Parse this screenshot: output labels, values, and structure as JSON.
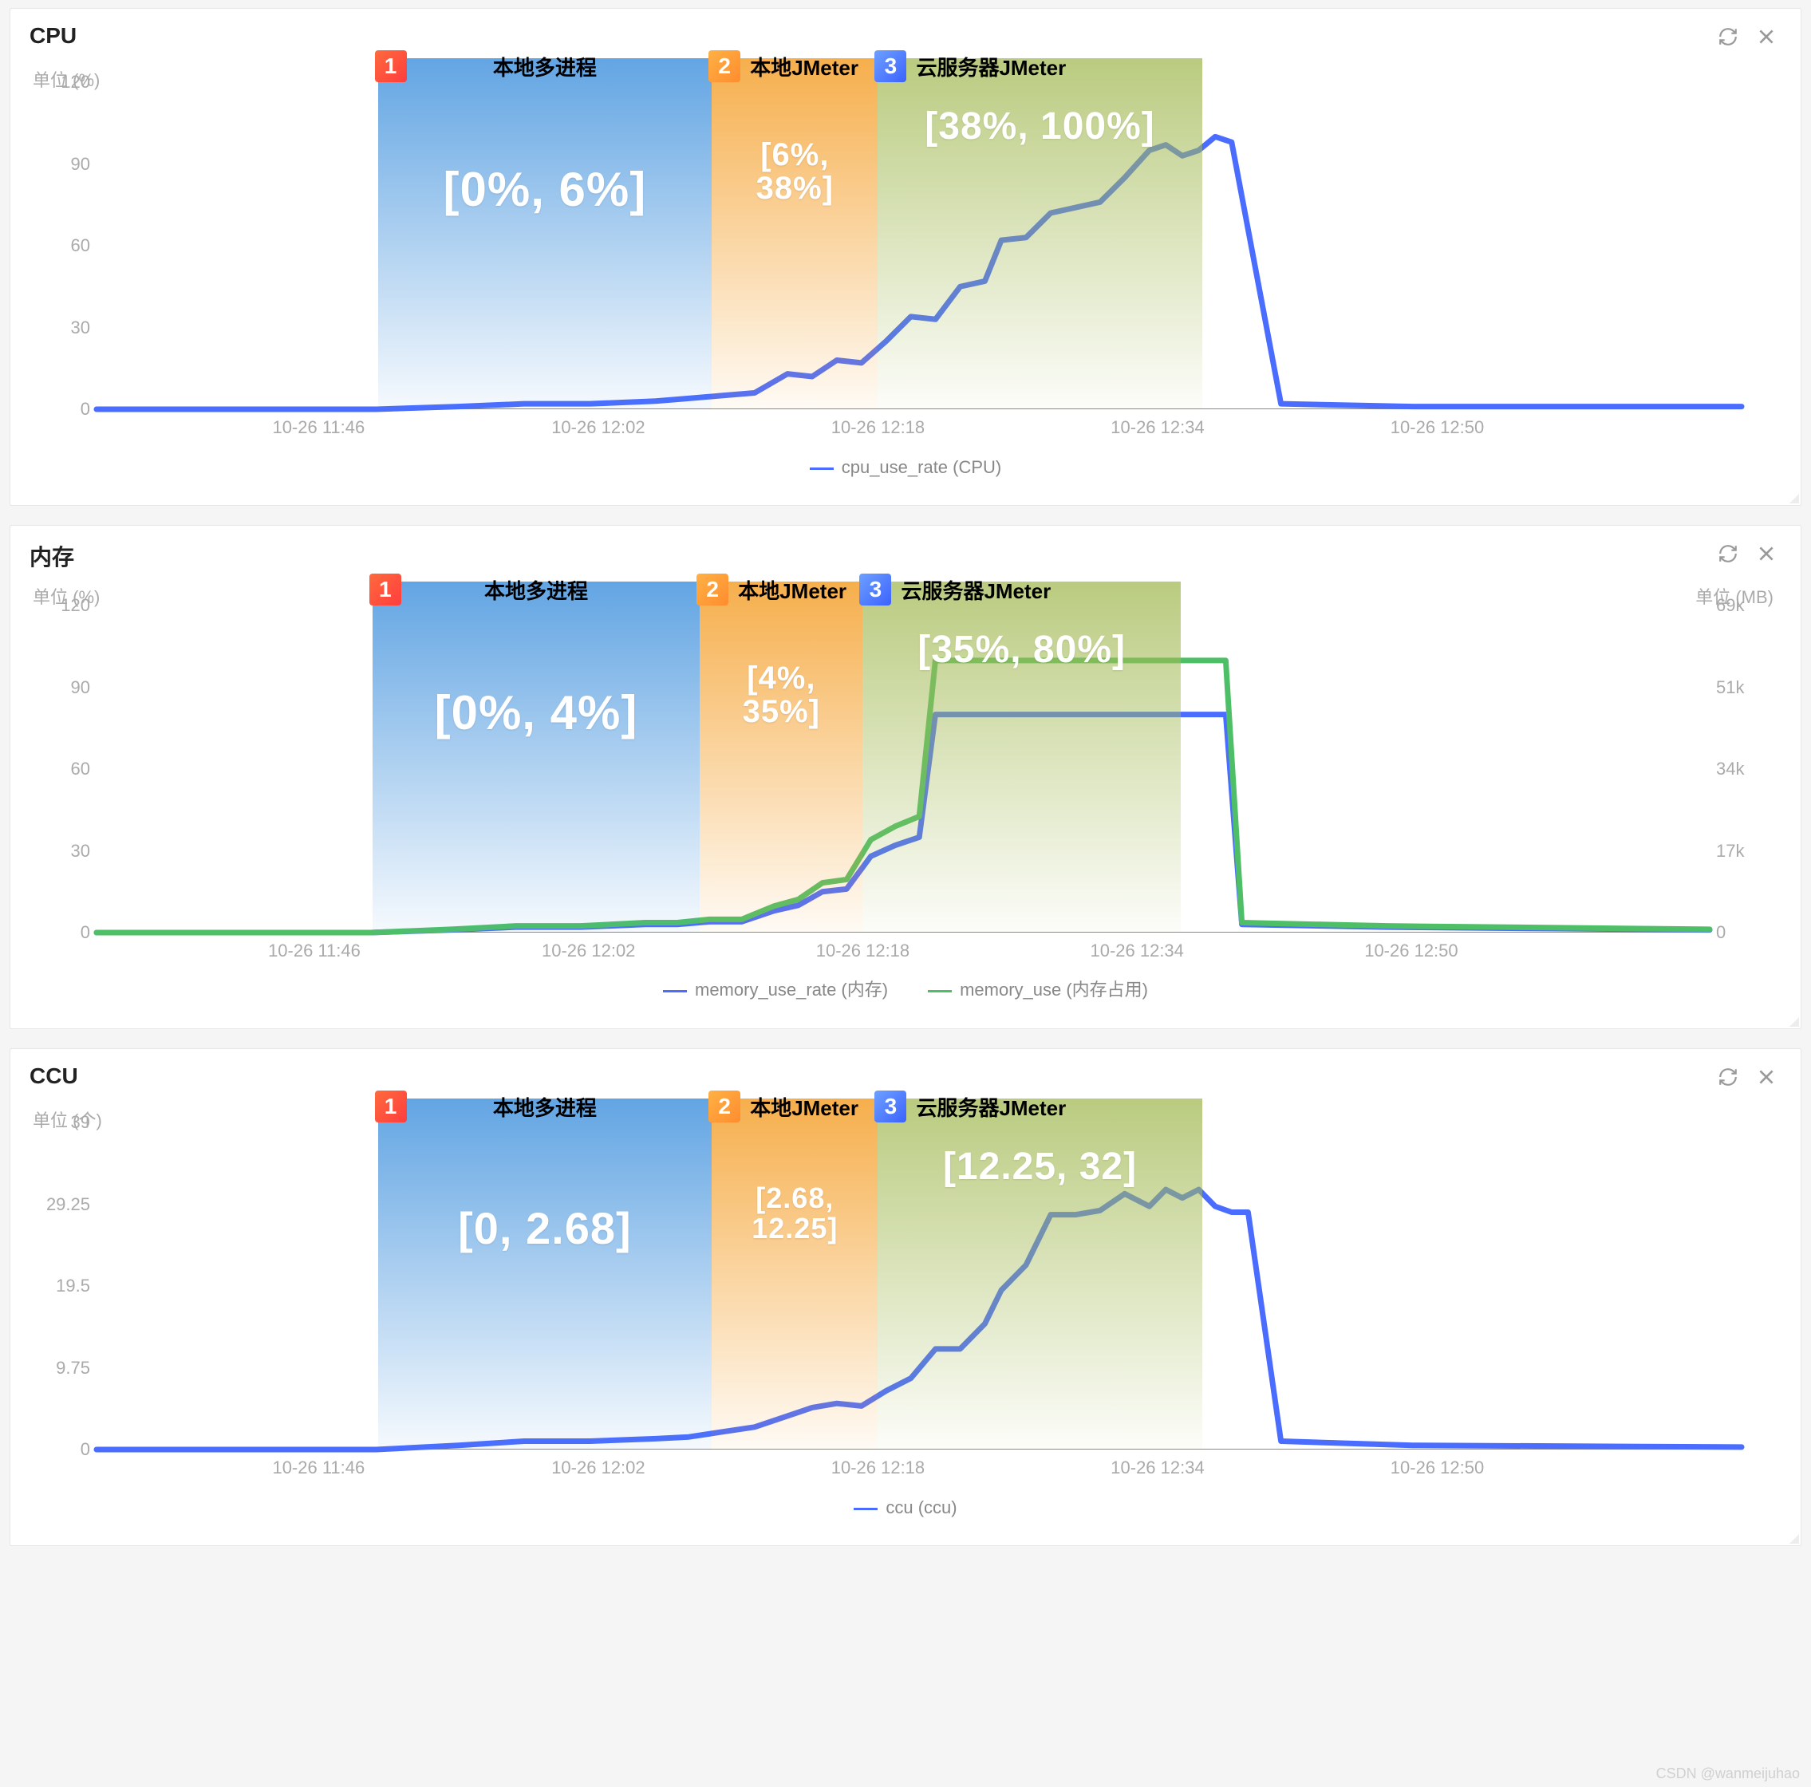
{
  "watermark": "CSDN @wanmeijuhao",
  "x_labels": [
    "10-26 11:46",
    "10-26 12:02",
    "10-26 12:18",
    "10-26 12:34",
    "10-26 12:50"
  ],
  "x_positions_pct": [
    13.5,
    30.5,
    47.5,
    64.5,
    81.5
  ],
  "bands": {
    "b1": {
      "label": "本地多进程",
      "badge": "1",
      "left_pct": 17.1,
      "width_pct": 20.3
    },
    "b2": {
      "label": "本地JMeter",
      "badge": "2",
      "left_pct": 37.4,
      "width_pct": 10.1
    },
    "b3": {
      "label": "云服务器JMeter",
      "badge": "3",
      "left_pct": 47.5,
      "width_pct": 19.7
    }
  },
  "panels": [
    {
      "id": "cpu",
      "title": "CPU",
      "unit_left": "单位 (%)",
      "y_ticks": [
        0,
        30,
        60,
        90,
        120
      ],
      "legend": [
        {
          "label": "cpu_use_rate (CPU)",
          "color": "#4a6cff"
        }
      ],
      "ranges": {
        "b1": "[0%, 6%]",
        "b2": "[6%, 38%]",
        "b3": "[38%, 100%]"
      },
      "range_font": {
        "b1": 60,
        "b2": 40,
        "b3": 48
      },
      "range_top": {
        "b1": 130,
        "b2": 100,
        "b3": 58
      }
    },
    {
      "id": "mem",
      "title": "内存",
      "unit_left": "单位 (%)",
      "unit_right": "单位 (MB)",
      "y_ticks": [
        0,
        30,
        60,
        90,
        120
      ],
      "y_ticks_right": [
        "0",
        "17k",
        "34k",
        "51k",
        "69k"
      ],
      "legend": [
        {
          "label": "memory_use_rate (内存)",
          "color": "#4a6cff"
        },
        {
          "label": "memory_use (内存占用)",
          "color": "#4fbf67"
        }
      ],
      "ranges": {
        "b1": "[0%, 4%]",
        "b2": "[4%, 35%]",
        "b3": "[35%, 80%]"
      },
      "range_font": {
        "b1": 60,
        "b2": 40,
        "b3": 48
      },
      "range_top": {
        "b1": 130,
        "b2": 100,
        "b3": 58
      }
    },
    {
      "id": "ccu",
      "title": "CCU",
      "unit_left": "单位 (个)",
      "y_ticks": [
        0,
        9.75,
        19.5,
        29.25,
        39
      ],
      "legend": [
        {
          "label": "ccu (ccu)",
          "color": "#4a6cff"
        }
      ],
      "ranges": {
        "b1": "[0, 2.68]",
        "b2": "[2.68, 12.25]",
        "b3": "[12.25, 32]"
      },
      "range_font": {
        "b1": 56,
        "b2": 36,
        "b3": 48
      },
      "range_top": {
        "b1": 130,
        "b2": 106,
        "b3": 58
      }
    }
  ],
  "chart_data": [
    {
      "id": "cpu",
      "type": "line",
      "title": "CPU",
      "xlabel": "",
      "ylabel": "单位 (%)",
      "ylim": [
        0,
        120
      ],
      "x": [
        0,
        6,
        12,
        17,
        22,
        26,
        30,
        34,
        36,
        38,
        40,
        42,
        43.5,
        45,
        46.5,
        48,
        49.5,
        51,
        52.5,
        54,
        55,
        56.5,
        58,
        59.5,
        61,
        62.5,
        64,
        65,
        66,
        67,
        68,
        69,
        72,
        80,
        100
      ],
      "series": [
        {
          "name": "cpu_use_rate (CPU)",
          "color": "#4a6cff",
          "values": [
            0,
            0,
            0,
            0,
            1,
            2,
            2,
            3,
            4,
            5,
            6,
            13,
            12,
            18,
            17,
            25,
            34,
            33,
            45,
            47,
            62,
            63,
            72,
            74,
            76,
            85,
            95,
            97,
            93,
            95,
            100,
            98,
            2,
            1,
            1
          ]
        }
      ]
    },
    {
      "id": "mem",
      "type": "line",
      "title": "内存",
      "xlabel": "",
      "ylabel": "单位 (%)",
      "ylim": [
        0,
        120
      ],
      "y2label": "单位 (MB)",
      "y2lim": [
        0,
        69000
      ],
      "x": [
        0,
        6,
        12,
        17,
        22,
        26,
        30,
        34,
        36,
        38,
        40,
        42,
        43.5,
        45,
        46.5,
        48,
        49.5,
        51,
        52,
        69,
        70,
        71,
        80,
        100
      ],
      "series": [
        {
          "name": "memory_use_rate (内存)",
          "color": "#4a6cff",
          "axis": "left",
          "values": [
            0,
            0,
            0,
            0,
            1,
            2,
            2,
            3,
            3,
            4,
            4,
            8,
            10,
            15,
            16,
            28,
            32,
            35,
            80,
            80,
            80,
            3,
            2,
            1
          ]
        },
        {
          "name": "memory_use (内存占用)",
          "color": "#4fbf67",
          "axis": "right",
          "values": [
            0,
            0,
            0,
            0,
            700,
            1400,
            1400,
            2100,
            2100,
            2800,
            2800,
            5600,
            7000,
            10500,
            11200,
            19600,
            22400,
            24500,
            57400,
            57400,
            57400,
            2100,
            1400,
            700
          ]
        }
      ]
    },
    {
      "id": "ccu",
      "type": "line",
      "title": "CCU",
      "xlabel": "",
      "ylabel": "单位 (个)",
      "ylim": [
        0,
        39
      ],
      "x": [
        0,
        6,
        12,
        17,
        22,
        26,
        30,
        34,
        36,
        38,
        40,
        42,
        43.5,
        45,
        46.5,
        48,
        49.5,
        51,
        52.5,
        54,
        55,
        56.5,
        58,
        59.5,
        61,
        62.5,
        64,
        65,
        66,
        67,
        68,
        69,
        70,
        72,
        80,
        100
      ],
      "series": [
        {
          "name": "ccu (ccu)",
          "color": "#4a6cff",
          "values": [
            0,
            0,
            0,
            0,
            0.5,
            1,
            1,
            1.3,
            1.5,
            2.1,
            2.68,
            4,
            5,
            5.5,
            5.2,
            7,
            8.5,
            12,
            12,
            15,
            19,
            22,
            28,
            28,
            28.5,
            30.5,
            29,
            31,
            30,
            31,
            29,
            28.3,
            28.3,
            1,
            0.5,
            0.3
          ]
        }
      ]
    }
  ]
}
